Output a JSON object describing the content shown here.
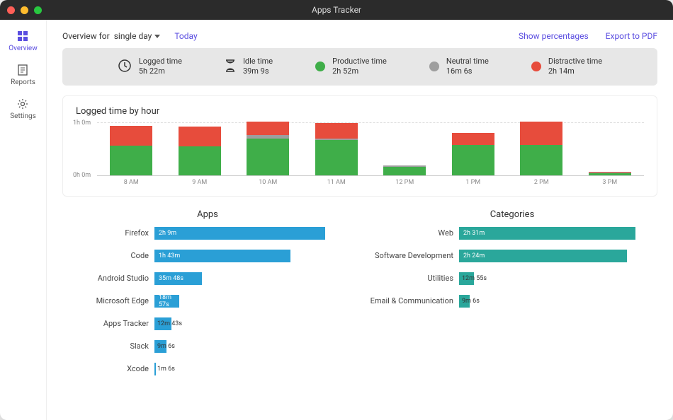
{
  "window": {
    "title": "Apps Tracker"
  },
  "sidebar": {
    "items": [
      {
        "label": "Overview",
        "active": true
      },
      {
        "label": "Reports"
      },
      {
        "label": "Settings"
      }
    ]
  },
  "topbar": {
    "overview_for": "Overview for",
    "range": "single day",
    "today": "Today",
    "show_percentages": "Show percentages",
    "export_pdf": "Export to PDF"
  },
  "summary": {
    "logged": {
      "label": "Logged time",
      "value": "5h 22m"
    },
    "idle": {
      "label": "Idle time",
      "value": "39m 9s"
    },
    "productive": {
      "label": "Productive time",
      "value": "2h 52m",
      "color": "#3fae49"
    },
    "neutral": {
      "label": "Neutral time",
      "value": "16m 6s",
      "color": "#9e9e9e"
    },
    "distractive": {
      "label": "Distractive time",
      "value": "2h 14m",
      "color": "#e74c3c"
    }
  },
  "hour_section_title": "Logged time by hour",
  "chart_data": [
    {
      "type": "bar",
      "title": "Logged time by hour",
      "xlabel": "",
      "ylabel": "",
      "ylim": [
        0,
        60
      ],
      "yticks": [
        "0h 0m",
        "1h 0m"
      ],
      "categories": [
        "8 AM",
        "9 AM",
        "10 AM",
        "11 AM",
        "12 PM",
        "1 PM",
        "2 PM",
        "3 PM"
      ],
      "series": [
        {
          "name": "Productive",
          "color": "#3fae49",
          "values": [
            33,
            32,
            41,
            39,
            9,
            34,
            34,
            2
          ]
        },
        {
          "name": "Neutral",
          "color": "#9e9e9e",
          "values": [
            0,
            0,
            4,
            2,
            2,
            0,
            0,
            1
          ]
        },
        {
          "name": "Distractive",
          "color": "#e74c3c",
          "values": [
            22,
            22,
            15,
            17,
            0,
            13,
            26,
            1
          ]
        }
      ]
    },
    {
      "type": "bar",
      "orientation": "horizontal",
      "title": "Apps",
      "color": "#2a9fd6",
      "max_minutes": 150,
      "categories": [
        "Firefox",
        "Code",
        "Android Studio",
        "Microsoft Edge",
        "Apps Tracker",
        "Slack",
        "Xcode"
      ],
      "values_label": [
        "2h 9m",
        "1h 43m",
        "35m 48s",
        "18m 57s",
        "12m 43s",
        "9m 6s",
        "1m 6s"
      ],
      "values": [
        129,
        103,
        35.8,
        18.95,
        12.7,
        9.1,
        1.1
      ]
    },
    {
      "type": "bar",
      "orientation": "horizontal",
      "title": "Categories",
      "color": "#2aa79b",
      "max_minutes": 170,
      "categories": [
        "Web",
        "Software Development",
        "Utilities",
        "Email & Communication"
      ],
      "values_label": [
        "2h 31m",
        "2h 24m",
        "12m 55s",
        "9m 6s"
      ],
      "values": [
        151,
        144,
        12.9,
        9.1
      ]
    }
  ]
}
